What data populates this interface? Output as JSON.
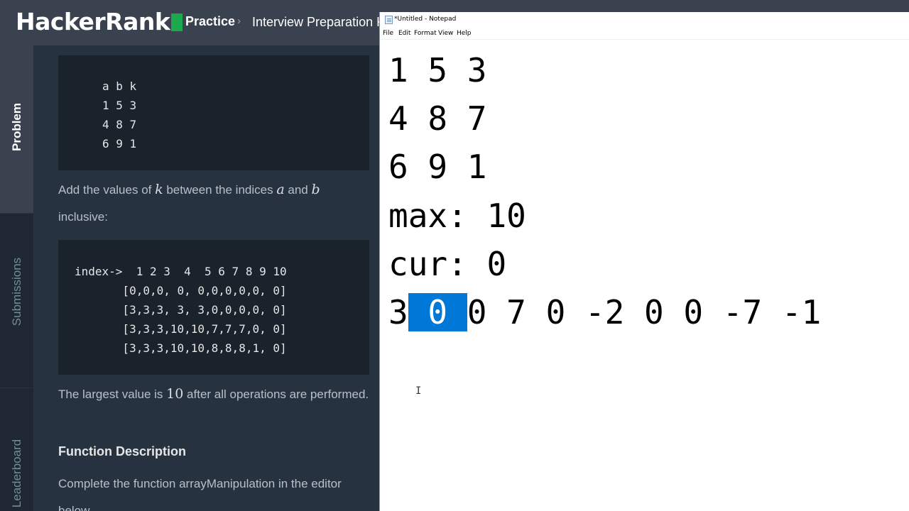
{
  "hackerrank": {
    "logo": "HackerRank",
    "breadcrumb": {
      "practice": "Practice",
      "separator": "›",
      "section": "Interview Preparation K"
    },
    "tabs": [
      "Problem",
      "Submissions",
      "Leaderboard"
    ],
    "active_tab": "Problem",
    "problem": {
      "codeblock_1": "a b k\n1 5 3\n4 8 7\n6 9 1",
      "para1": {
        "t1": "Add the values of ",
        "m1": "k",
        "t2": " between the indices ",
        "m2": "a",
        "t3": " and ",
        "m3": "b",
        "t4": "inclusive:"
      },
      "codeblock_2": "index->  1 2 3  4  5 6 7 8 9 10\n       [0,0,0, 0, 0,0,0,0,0, 0]\n       [3,3,3, 3, 3,0,0,0,0, 0]\n       [3,3,3,10,10,7,7,7,0, 0]\n       [3,3,3,10,10,8,8,8,1, 0]",
      "para2": {
        "t1": "The largest value is ",
        "m1": "10",
        "t2": " after all operations are performed."
      },
      "heading": "Function Description",
      "para3": "Complete the function arrayManipulation in the editor below."
    }
  },
  "notepad": {
    "title": "*Untitled - Notepad",
    "menu": [
      "File",
      "Edit",
      "Format",
      "View",
      "Help"
    ],
    "lines": {
      "l1": "1 5 3",
      "l2": "4 8 7",
      "l3": "6 9 1",
      "l4": "max: 10",
      "l5": "cur: 0",
      "l6_pre": "3",
      "l6_sel": " 0 ",
      "l6_post": "0 7 0 -2 0 0 -7 -1"
    }
  },
  "colors": {
    "hr_green": "#1ba94c",
    "selection": "#0078d7"
  }
}
